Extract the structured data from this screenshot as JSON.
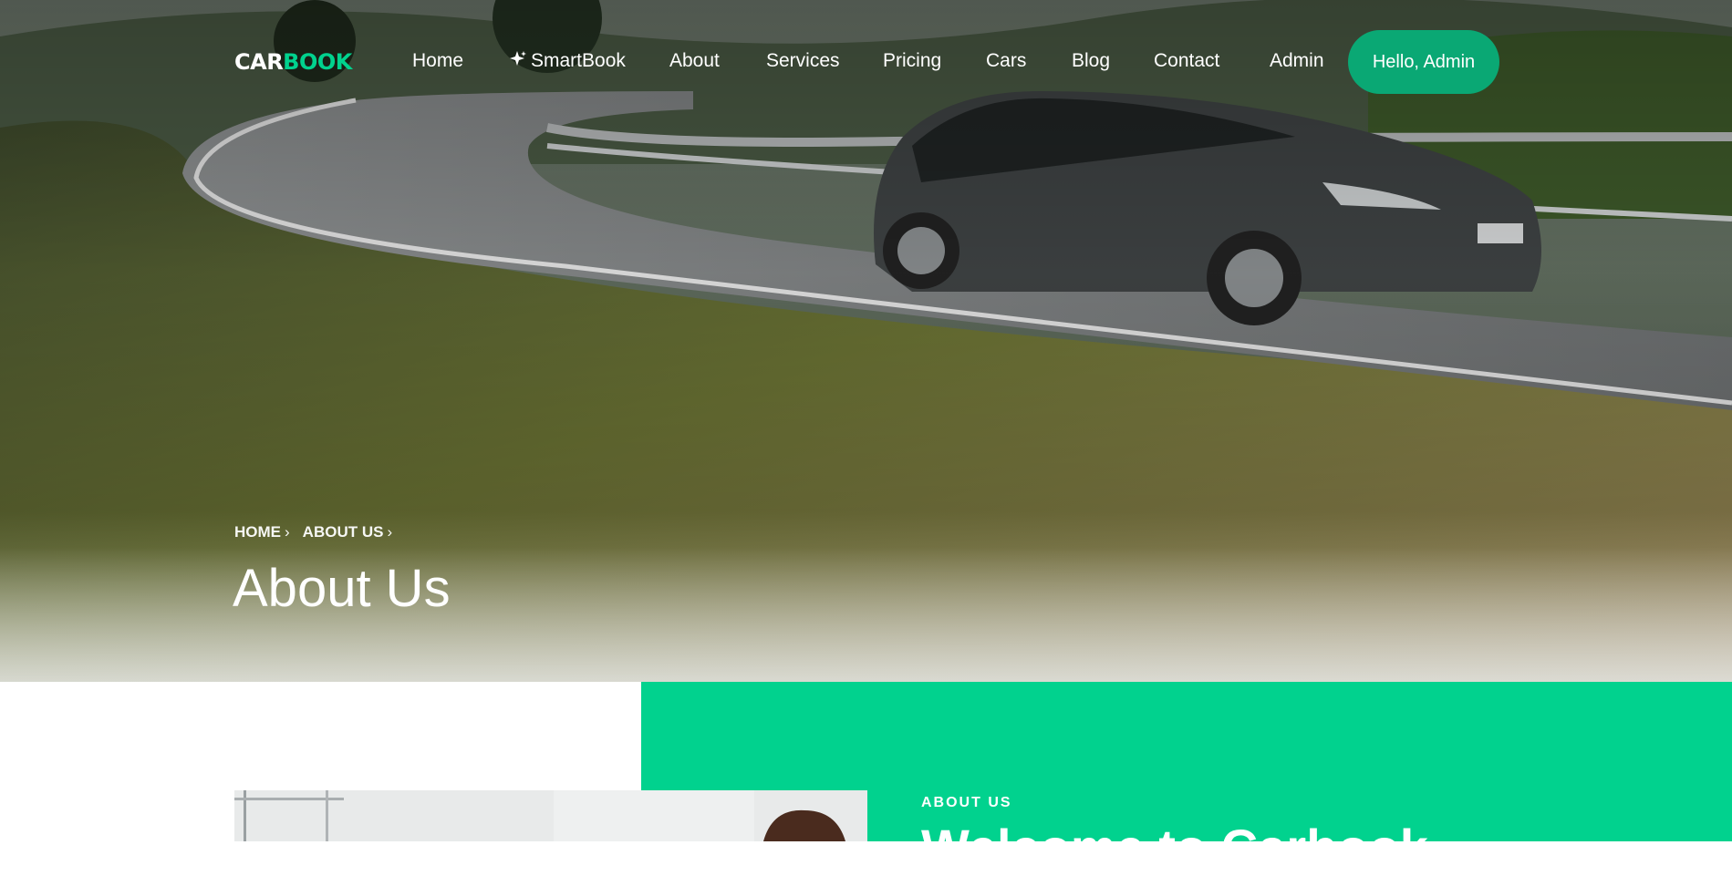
{
  "brand": {
    "part1": "CAR",
    "part2": "BOOK"
  },
  "nav": {
    "items": [
      {
        "label": "Home"
      },
      {
        "label": "SmartBook",
        "icon": "sparkle-icon"
      },
      {
        "label": "About"
      },
      {
        "label": "Services"
      },
      {
        "label": "Pricing"
      },
      {
        "label": "Cars"
      },
      {
        "label": "Blog"
      },
      {
        "label": "Contact"
      },
      {
        "label": "Admin"
      }
    ],
    "cta_label": "Hello, Admin"
  },
  "hero": {
    "breadcrumb": [
      {
        "label": "HOME"
      },
      {
        "label": "ABOUT US"
      }
    ],
    "title": "About Us"
  },
  "about": {
    "label": "ABOUT US",
    "heading": "Welcome to Carbook"
  },
  "colors": {
    "accent": "#01d28e",
    "cta": "#0aa874"
  }
}
